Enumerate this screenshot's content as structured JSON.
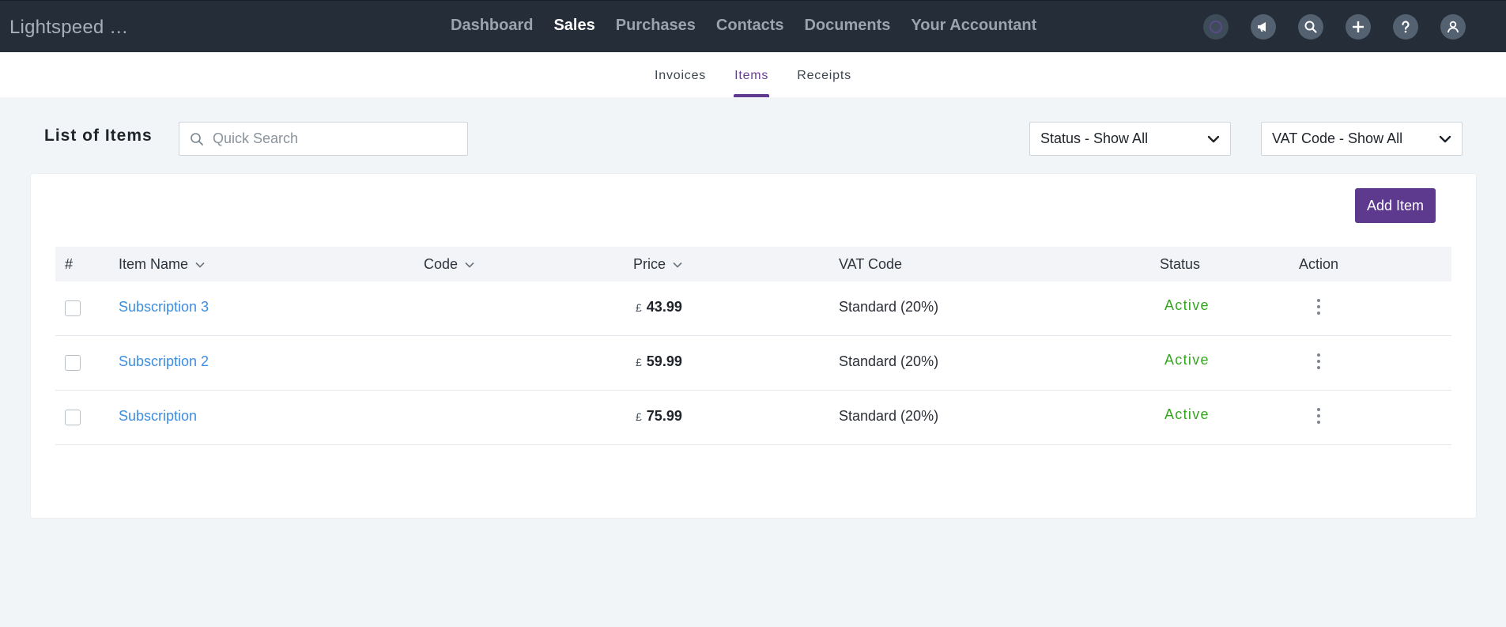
{
  "app": {
    "brand": "Lightspeed …"
  },
  "nav": {
    "items": [
      "Dashboard",
      "Sales",
      "Purchases",
      "Contacts",
      "Documents",
      "Your Accountant"
    ],
    "active": "Sales"
  },
  "topbar_icons": [
    "account-circle-icon",
    "megaphone-icon",
    "search-icon",
    "plus-icon",
    "help-icon",
    "user-icon"
  ],
  "subnav": {
    "tabs": [
      "Invoices",
      "Items",
      "Receipts"
    ],
    "active": "Items"
  },
  "page": {
    "title": "List of Items"
  },
  "search": {
    "placeholder": "Quick Search",
    "value": ""
  },
  "filters": {
    "status": "Status - Show All",
    "vat_code": "VAT Code - Show All"
  },
  "actions": {
    "add_item": "Add Item"
  },
  "table": {
    "columns": {
      "num": "#",
      "item_name": "Item Name",
      "code": "Code",
      "price": "Price",
      "vat_code": "VAT Code",
      "status": "Status",
      "action": "Action"
    },
    "rows": [
      {
        "name": "Subscription 3",
        "code": "",
        "currency": "£",
        "price": "43.99",
        "vat": "Standard (20%)",
        "status": "Active"
      },
      {
        "name": "Subscription 2",
        "code": "",
        "currency": "£",
        "price": "59.99",
        "vat": "Standard (20%)",
        "status": "Active"
      },
      {
        "name": "Subscription",
        "code": "",
        "currency": "£",
        "price": "75.99",
        "vat": "Standard (20%)",
        "status": "Active"
      }
    ]
  },
  "colors": {
    "topbar": "#242d38",
    "accent": "#5e3a8f",
    "link": "#3d8de0",
    "status_active": "#33a51f"
  }
}
